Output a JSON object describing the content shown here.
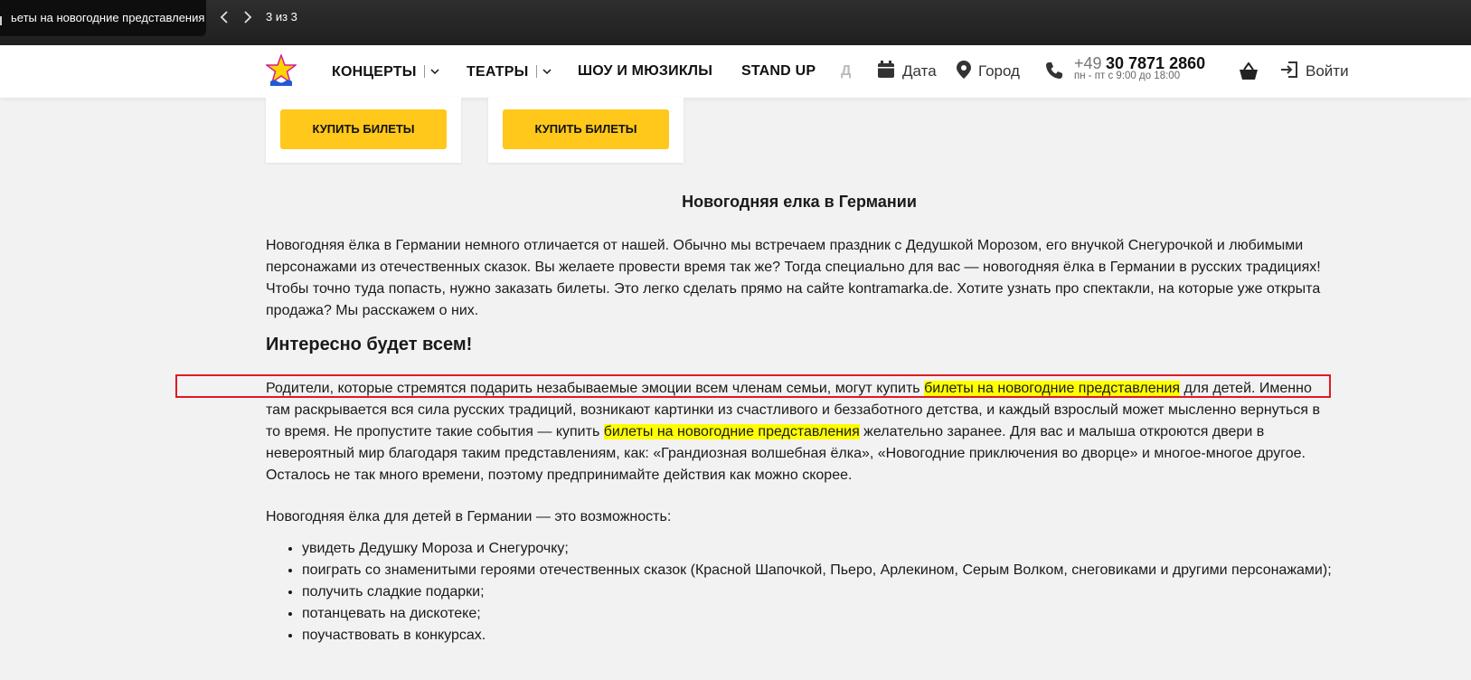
{
  "find_bar": {
    "query": "ьеты на новогодние представления",
    "count": "3 из 3",
    "prev_icon": "chevron-left-icon",
    "next_icon": "chevron-right-icon"
  },
  "header": {
    "nav": [
      {
        "label": "КОНЦЕРТЫ",
        "has_dropdown": true
      },
      {
        "label": "ТЕАТРЫ",
        "has_dropdown": true
      },
      {
        "label": "ШОУ И МЮЗИКЛЫ",
        "has_dropdown": false
      },
      {
        "label": "STAND UP",
        "has_dropdown": false
      },
      {
        "label": "Д",
        "has_dropdown": false
      }
    ],
    "date_label": "Дата",
    "city_label": "Город",
    "phone_prefix": "+49",
    "phone_number": "30 7871 2860",
    "phone_hours": "пн - пт с 9:00 до 18:00",
    "login_label": "Войти"
  },
  "cards": [
    {
      "button_label": "КУПИТЬ БИЛЕТЫ"
    },
    {
      "button_label": "КУПИТЬ БИЛЕТЫ"
    }
  ],
  "article": {
    "title": "Новогодняя елка в Германии",
    "intro": "Новогодняя ёлка в Германии немного отличается от нашей. Обычно мы встречаем праздник с Дедушкой Морозом, его внучкой Снегурочкой и любимыми персонажами из отечественных сказок. Вы желаете провести время так же? Тогда специально для вас — новогодняя ёлка в Германии в русских традициях! Чтобы точно туда попасть, нужно заказать билеты. Это легко сделать прямо на сайте kontramarka.de. Хотите узнать про спектакли, на которые уже открыта продажа? Мы расскажем о них.",
    "subtitle": "Интересно будет всем!",
    "p2_a": "Родители, которые стремятся подарить незабываемые эмоции всем членам семьи, могут купить ",
    "p2_hl1": "билеты на новогодние представления",
    "p2_b": " для детей. Именно там раскрывается вся сила русских традиций, возникают картинки из счастливого и беззаботного детства, и каждый взрослый может мысленно вернуться в то время. Не пропустите такие события — купить ",
    "p2_hl2": "билеты на новогодние представления",
    "p2_c": " желательно заранее. Для вас и малыша откроются двери в невероятный мир благодаря таким представлениям, как: «Грандиозная волшебная ёлка», «Новогодние приключения во дворце» и многое-многое другое. Осталось не так много времени, поэтому предпринимайте действия как можно скорее.",
    "p3": "Новогодняя ёлка для детей в Германии — это возможность:",
    "list": [
      "увидеть Дедушку Мороза и Снегурочку;",
      "поиграть со знаменитыми героями отечественных сказок (Красной Шапочкой, Пьеро, Арлекином, Серым Волком, снеговиками и другими персонажами);",
      "получить сладкие подарки;",
      "потанцевать на дискотеке;",
      "поучаствовать в конкурсах."
    ]
  },
  "colors": {
    "accent_yellow": "#ffc81a",
    "highlight": "#ffff00",
    "annotation_red": "#e01a22"
  }
}
